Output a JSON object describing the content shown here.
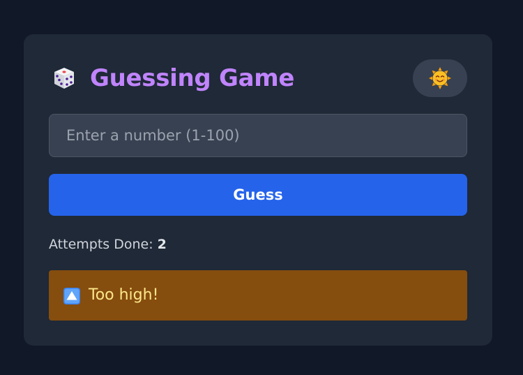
{
  "game": {
    "title": "Guessing Game",
    "dice_icon": "dice-icon",
    "theme_icon": "sun-smiling-icon"
  },
  "input": {
    "value": "",
    "placeholder": "Enter a number (1-100)"
  },
  "guess_button": {
    "label": "Guess"
  },
  "attempts": {
    "label": "Attempts Done:",
    "count": "2"
  },
  "feedback": {
    "icon": "up-arrow-icon",
    "text": "Too high!"
  },
  "colors": {
    "background": "#111827",
    "card": "#1f2937",
    "title": "#c084fc",
    "button": "#2563eb",
    "feedback_bg": "#854d0e",
    "feedback_text": "#fde68a"
  }
}
